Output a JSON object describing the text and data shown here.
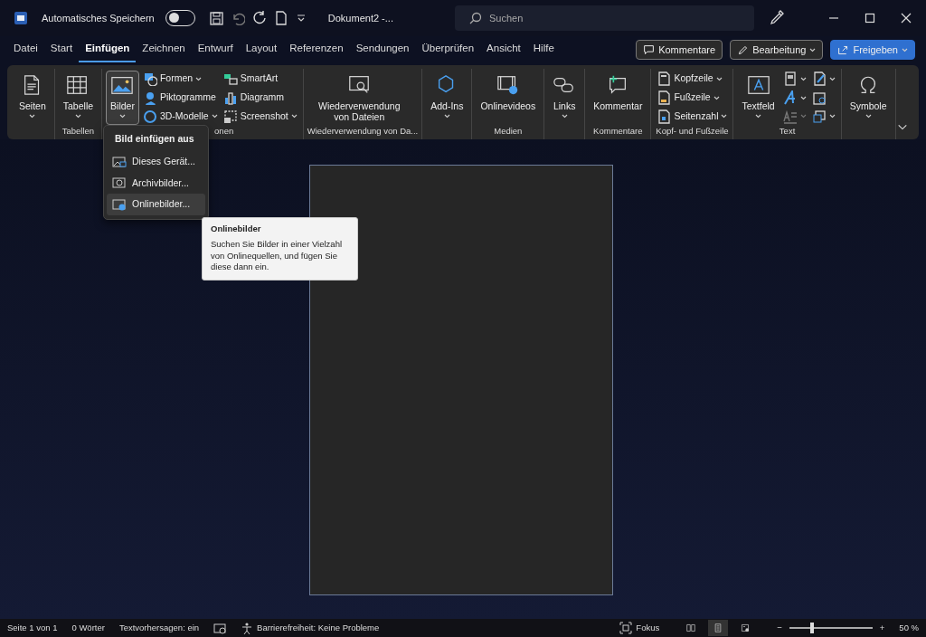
{
  "title_bar": {
    "autosave_label": "Automatisches Speichern",
    "autosave_on": false,
    "document_title": "Dokument2  -...",
    "search_placeholder": "Suchen"
  },
  "menu_tabs": [
    {
      "label": "Datei",
      "selected": false
    },
    {
      "label": "Start",
      "selected": false
    },
    {
      "label": "Einfügen",
      "selected": true
    },
    {
      "label": "Zeichnen",
      "selected": false
    },
    {
      "label": "Entwurf",
      "selected": false
    },
    {
      "label": "Layout",
      "selected": false
    },
    {
      "label": "Referenzen",
      "selected": false
    },
    {
      "label": "Sendungen",
      "selected": false
    },
    {
      "label": "Überprüfen",
      "selected": false
    },
    {
      "label": "Ansicht",
      "selected": false
    },
    {
      "label": "Hilfe",
      "selected": false
    }
  ],
  "header_buttons": [
    {
      "label": "Kommentare",
      "kind": "outline",
      "dropdown": false
    },
    {
      "label": "Bearbeitung",
      "kind": "outline",
      "dropdown": true
    },
    {
      "label": "Freigeben",
      "kind": "primary",
      "dropdown": true
    }
  ],
  "ribbon": {
    "groups": [
      {
        "items": [
          {
            "kind": "large",
            "label": "Seiten",
            "dropdown": true,
            "pressed": false,
            "disabled": false
          }
        ]
      },
      {
        "label": "Tabellen",
        "items": [
          {
            "kind": "large",
            "label": "Tabelle",
            "dropdown": true,
            "pressed": false,
            "disabled": false
          }
        ]
      },
      {
        "label": "onen",
        "items": [
          {
            "kind": "large",
            "label": "Bilder",
            "dropdown": true,
            "pressed": true,
            "disabled": false
          },
          {
            "kind": "small",
            "label": "Formen",
            "dropdown": true,
            "pressed": false,
            "disabled": false
          },
          {
            "kind": "small",
            "label": "Piktogramme",
            "dropdown": false,
            "pressed": false,
            "disabled": false
          },
          {
            "kind": "small",
            "label": "3D-Modelle",
            "dropdown": true,
            "pressed": false,
            "disabled": false
          },
          {
            "kind": "small",
            "label": "SmartArt",
            "dropdown": false,
            "pressed": false,
            "disabled": false
          },
          {
            "kind": "small",
            "label": "Diagramm",
            "dropdown": false,
            "pressed": false,
            "disabled": false
          },
          {
            "kind": "small",
            "label": "Screenshot",
            "dropdown": true,
            "pressed": false,
            "disabled": false
          }
        ]
      },
      {
        "label": "Wiederverwendung von Da...",
        "items": [
          {
            "kind": "large",
            "label": "Wiederverwendung von Dateien",
            "dropdown": false,
            "pressed": false,
            "disabled": false
          }
        ]
      },
      {
        "items": [
          {
            "kind": "large",
            "label": "Add-Ins",
            "dropdown": true,
            "pressed": false,
            "disabled": false
          }
        ]
      },
      {
        "label": "Medien",
        "items": [
          {
            "kind": "large",
            "label": "Onlinevideos",
            "dropdown": false,
            "pressed": false,
            "disabled": false
          }
        ]
      },
      {
        "items": [
          {
            "kind": "large",
            "label": "Links",
            "dropdown": true,
            "pressed": false,
            "disabled": false
          }
        ]
      },
      {
        "label": "Kommentare",
        "items": [
          {
            "kind": "large",
            "label": "Kommentar",
            "dropdown": false,
            "pressed": false,
            "disabled": false
          }
        ]
      },
      {
        "label": "Kopf- und Fußzeile",
        "items": [
          {
            "kind": "small",
            "label": "Kopfzeile",
            "dropdown": true,
            "pressed": false,
            "disabled": false
          },
          {
            "kind": "small",
            "label": "Fußzeile",
            "dropdown": true,
            "pressed": false,
            "disabled": false
          },
          {
            "kind": "small",
            "label": "Seitenzahl",
            "dropdown": true,
            "pressed": false,
            "disabled": false
          }
        ]
      },
      {
        "label": "Text",
        "items": [
          {
            "kind": "large",
            "label": "Textfeld",
            "dropdown": true,
            "pressed": false,
            "disabled": false
          },
          {
            "kind": "icon",
            "dropdown": true,
            "pressed": false,
            "disabled": false
          },
          {
            "kind": "icon",
            "dropdown": true,
            "pressed": false,
            "disabled": false
          },
          {
            "kind": "icon",
            "dropdown": true,
            "pressed": false,
            "disabled": true
          },
          {
            "kind": "icon",
            "dropdown": true,
            "pressed": false,
            "disabled": false
          },
          {
            "kind": "icon",
            "dropdown": false,
            "pressed": false,
            "disabled": false
          },
          {
            "kind": "icon",
            "dropdown": true,
            "pressed": false,
            "disabled": false
          }
        ]
      },
      {
        "items": [
          {
            "kind": "large",
            "label": "Symbole",
            "dropdown": true,
            "pressed": false,
            "disabled": false
          }
        ]
      }
    ]
  },
  "pictures_menu": {
    "title": "Bild einfügen aus",
    "items": [
      {
        "label": "Dieses Gerät...",
        "selected": false
      },
      {
        "label": "Archivbilder...",
        "selected": false
      },
      {
        "label": "Onlinebilder...",
        "selected": true
      }
    ]
  },
  "tooltip": {
    "title": "Onlinebilder",
    "text": "Suchen Sie Bilder in einer Vielzahl von Onlinequellen, und fügen Sie diese dann ein."
  },
  "status_bar": {
    "page": "Seite 1 von 1",
    "words": "0 Wörter",
    "predictions": "Textvorhersagen: ein",
    "accessibility": "Barrierefreiheit: Keine Probleme",
    "focus": "Fokus",
    "views": [
      {
        "selected": false
      },
      {
        "selected": true
      },
      {
        "selected": false
      }
    ],
    "zoom": {
      "out": "−",
      "in": "+",
      "level": 0.27,
      "reading": "50 %"
    }
  }
}
